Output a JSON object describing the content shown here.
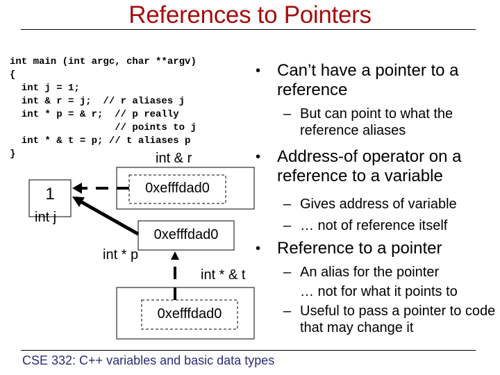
{
  "slide": {
    "title": "References to Pointers",
    "footer": "CSE 332: C++ variables and basic data types"
  },
  "code": {
    "lines": [
      "int main (int argc, char **argv)",
      "{",
      "  int j = 1;",
      "  int & r = j;  // r aliases j",
      "  int * p = & r;  // p really",
      "                  // points to j",
      "  int * & t = p; // t aliases p",
      "}"
    ]
  },
  "diagram": {
    "j": {
      "value": "1",
      "label": "int j"
    },
    "r": {
      "value": "0xefffdad0",
      "label": "int & r"
    },
    "p": {
      "value": "0xefffdad0",
      "label": "int * p"
    },
    "t": {
      "value": "0xefffdad0",
      "label": "int * & t"
    }
  },
  "bullets": [
    {
      "text": "Can’t have a pointer to a reference",
      "subs": [
        "But can point to what the reference aliases"
      ]
    },
    {
      "text": "Address-of operator on a reference to a variable",
      "subs": [
        "Gives address of variable",
        "… not of reference itself"
      ]
    },
    {
      "text": "Reference to a pointer",
      "subs": [
        "An alias for the pointer",
        "… not for what it points to",
        "Useful to pass a pointer to code that may change it"
      ]
    }
  ],
  "colors": {
    "title": "#a50d0d",
    "footer": "#2b2b7c"
  }
}
